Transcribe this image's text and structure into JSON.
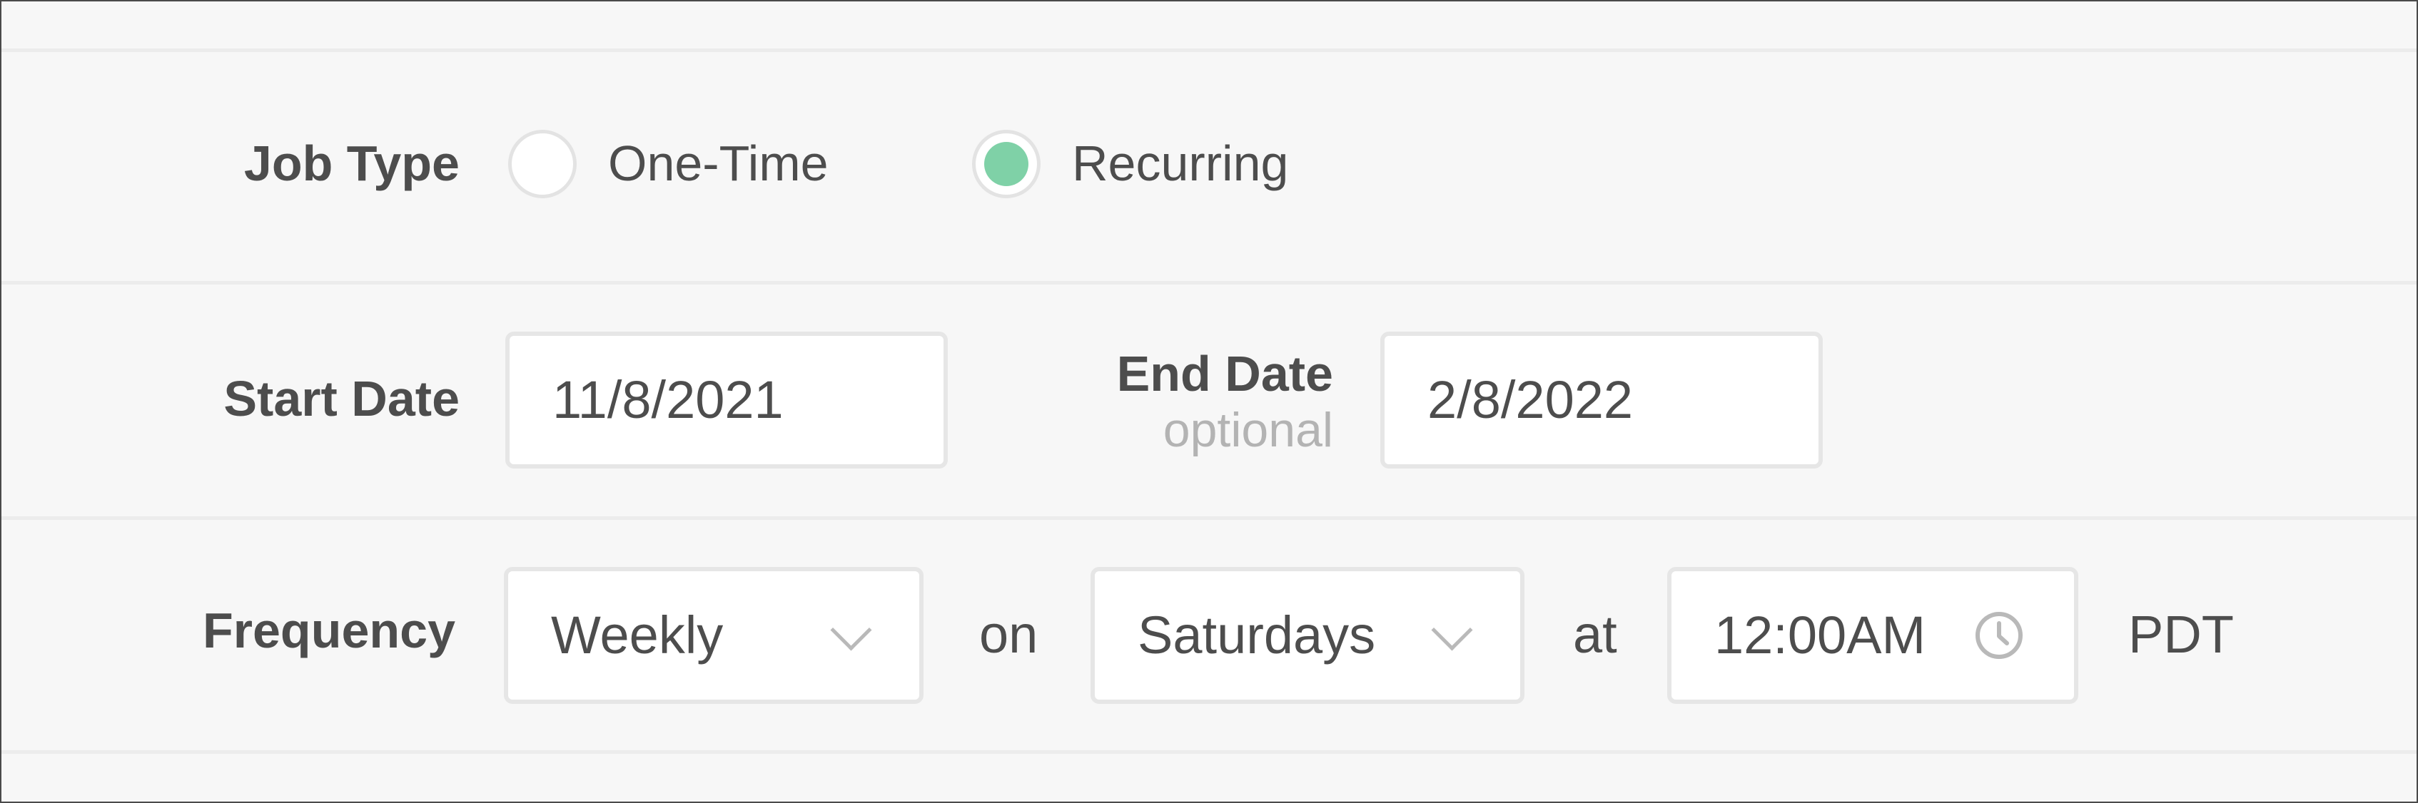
{
  "job_type": {
    "label": "Job Type",
    "options": [
      {
        "label": "One-Time",
        "selected": false
      },
      {
        "label": "Recurring",
        "selected": true
      }
    ],
    "selected_color": "#7fd1a7"
  },
  "dates": {
    "start_label": "Start Date",
    "start_value": "11/8/2021",
    "end_label": "End Date",
    "end_optional": "optional",
    "end_value": "2/8/2022"
  },
  "frequency": {
    "label": "Frequency",
    "interval_value": "Weekly",
    "on_text": "on",
    "day_value": "Saturdays",
    "at_text": "at",
    "time_value": "12:00AM",
    "timezone": "PDT",
    "icons": {
      "dropdown": "chevron-down-icon",
      "time": "clock-icon"
    }
  }
}
